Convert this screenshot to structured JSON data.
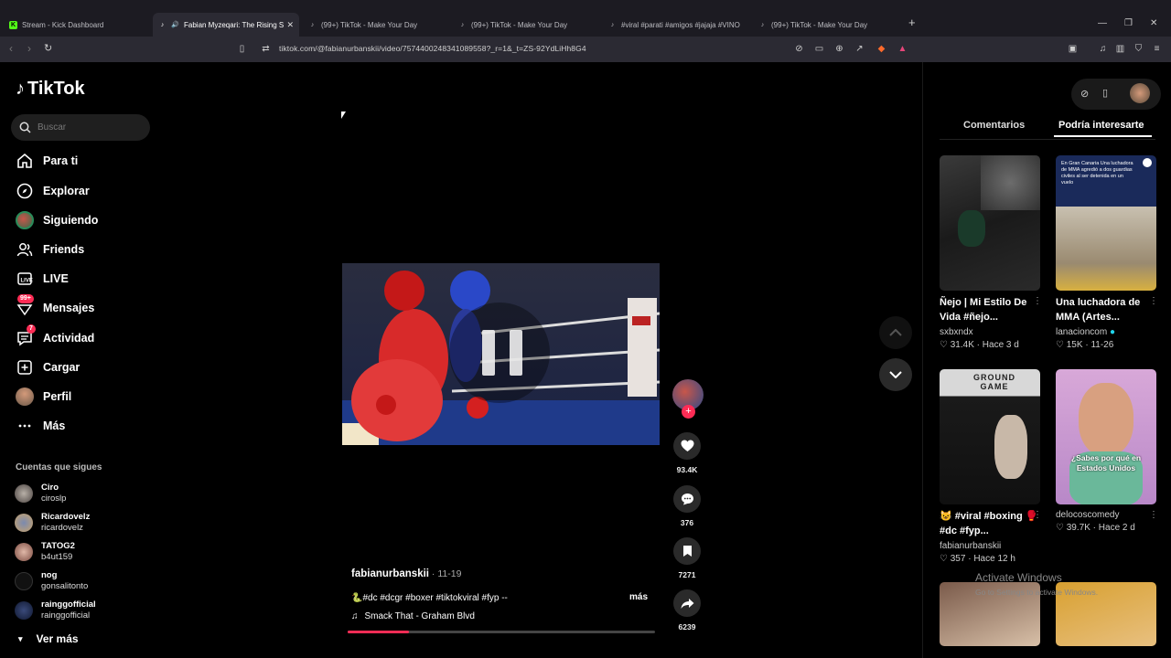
{
  "browser": {
    "tabs": [
      {
        "label": "Stream - Kick Dashboard",
        "active": false
      },
      {
        "label": "Fabian Myzeqari: The Rising S",
        "active": true
      },
      {
        "label": "(99+) TikTok - Make Your Day",
        "active": false
      },
      {
        "label": "(99+) TikTok - Make Your Day",
        "active": false
      },
      {
        "label": "#viral #parati #amigos #jajaja #VINO",
        "active": false
      },
      {
        "label": "(99+) TikTok - Make Your Day",
        "active": false
      }
    ],
    "url": "tiktok.com/@fabianurbanskii/video/7574400248341089558?_r=1&_t=ZS-92YdLiHh8G4"
  },
  "sidebar": {
    "logo": "TikTok",
    "search_placeholder": "Buscar",
    "menu": [
      {
        "label": "Para ti",
        "icon": "home-icon"
      },
      {
        "label": "Explorar",
        "icon": "compass-icon"
      },
      {
        "label": "Siguiendo",
        "icon": "following-avatar-icon"
      },
      {
        "label": "Friends",
        "icon": "friends-icon"
      },
      {
        "label": "LIVE",
        "icon": "live-icon"
      },
      {
        "label": "Mensajes",
        "icon": "messages-icon",
        "badge": "99+"
      },
      {
        "label": "Actividad",
        "icon": "activity-icon",
        "badge": "7"
      },
      {
        "label": "Cargar",
        "icon": "upload-icon"
      },
      {
        "label": "Perfil",
        "icon": "profile-avatar-icon"
      },
      {
        "label": "Más",
        "icon": "more-icon"
      }
    ],
    "following_title": "Cuentas que sigues",
    "following": [
      {
        "name": "Ciro",
        "handle": "ciroslp"
      },
      {
        "name": "Ricardovelz",
        "handle": "ricardovelz"
      },
      {
        "name": "TATOG2",
        "handle": "b4ut159"
      },
      {
        "name": "nog",
        "handle": "gonsalitonto"
      },
      {
        "name": "rainggofficial",
        "handle": "rainggofficial"
      }
    ],
    "see_more": "Ver más"
  },
  "video": {
    "author": "fabianurbanskii",
    "date": "11-19",
    "caption": "🐍#dc #dcgr #boxer #tiktokviral #fyp --",
    "more": "más",
    "music": "Smack That - Graham Blvd",
    "progress": 0.2,
    "likes": "93.4K",
    "comments": "376",
    "saves": "7271",
    "shares": "6239"
  },
  "right_panel": {
    "tabs": [
      "Comentarios",
      "Podría interesarte"
    ],
    "cards": [
      {
        "title": "Ñejo | Mi Estilo De Vida #ñejo...",
        "author": "sxbxndx",
        "likes": "31.4K",
        "time": "Hace 3 d"
      },
      {
        "title": "Una luchadora de MMA (Artes...",
        "author": "lanacioncom",
        "likes": "15K",
        "time": "11-26",
        "overlay": "En Gran Canaria Una luchadora de MMA agredió a dos guardias civiles al ser detenida en un vuelo"
      },
      {
        "title": "😺 #viral #boxing 🥊 #dc #fyp...",
        "author": "fabianurbanskii",
        "likes": "357",
        "time": "Hace 12 h",
        "overlay": "GROUND GAME"
      },
      {
        "title": "",
        "author": "delocoscomedy",
        "likes": "39.7K",
        "time": "Hace 2 d",
        "overlay": "¿Sabes por qué en Estados Unidos"
      }
    ]
  },
  "watermark": {
    "line1": "Activate Windows",
    "line2": "Go to Settings to activate Windows."
  },
  "colors": {
    "accent": "#fe2c55",
    "background": "#000000"
  }
}
